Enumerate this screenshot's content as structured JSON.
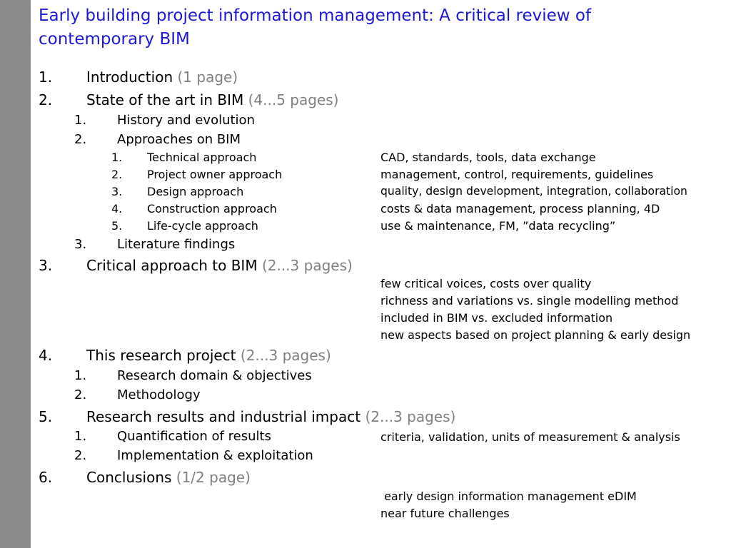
{
  "title": "Early building project information management: A critical review of contemporary BIM",
  "outline": {
    "s1": {
      "num": "1.",
      "label": "Introduction",
      "pages": "(1 page)"
    },
    "s2": {
      "num": "2.",
      "label": "State of the art in BIM",
      "pages": "(4...5 pages)"
    },
    "s2_1": {
      "num": "1.",
      "label": "History and evolution"
    },
    "s2_2": {
      "num": "2.",
      "label": "Approaches on BIM"
    },
    "s2_2_1": {
      "num": "1.",
      "label": "Technical approach",
      "note": "CAD, standards, tools, data exchange"
    },
    "s2_2_2": {
      "num": "2.",
      "label": "Project owner approach",
      "note": "management, control, requirements, guidelines"
    },
    "s2_2_3": {
      "num": "3.",
      "label": "Design approach",
      "note": "quality, design development, integration, collaboration"
    },
    "s2_2_4": {
      "num": "4.",
      "label": "Construction approach",
      "note": "costs & data management, process planning, 4D"
    },
    "s2_2_5": {
      "num": "5.",
      "label": "Life-cycle approach",
      "note": "use & maintenance, FM, ”data recycling”"
    },
    "s2_3": {
      "num": "3.",
      "label": "Literature findings"
    },
    "s3": {
      "num": "3.",
      "label": "Critical approach to BIM",
      "pages": "(2...3 pages)"
    },
    "s3_notes": [
      "few critical voices, costs over quality",
      "richness and variations vs. single modelling method",
      "included in BIM vs. excluded information",
      "new aspects based on project planning & early design"
    ],
    "s4": {
      "num": "4.",
      "label": "This research project",
      "pages": "(2...3 pages)"
    },
    "s4_1": {
      "num": "1.",
      "label": "Research domain & objectives"
    },
    "s4_2": {
      "num": "2.",
      "label": "Methodology"
    },
    "s5": {
      "num": "5.",
      "label": "Research results and industrial impact",
      "pages": "(2...3 pages)"
    },
    "s5_1": {
      "num": "1.",
      "label": "Quantification of results",
      "note": "criteria, validation, units of measurement & analysis"
    },
    "s5_2": {
      "num": "2.",
      "label": "Implementation & exploitation"
    },
    "s6": {
      "num": "6.",
      "label": "Conclusions",
      "pages": "(1/2 page)"
    },
    "s6_notes": [
      " early design information management eDIM",
      "near future challenges"
    ]
  },
  "colors": {
    "title": "#1a1ad6",
    "pages": "#808080",
    "sidebar": "#8c8c8c"
  }
}
